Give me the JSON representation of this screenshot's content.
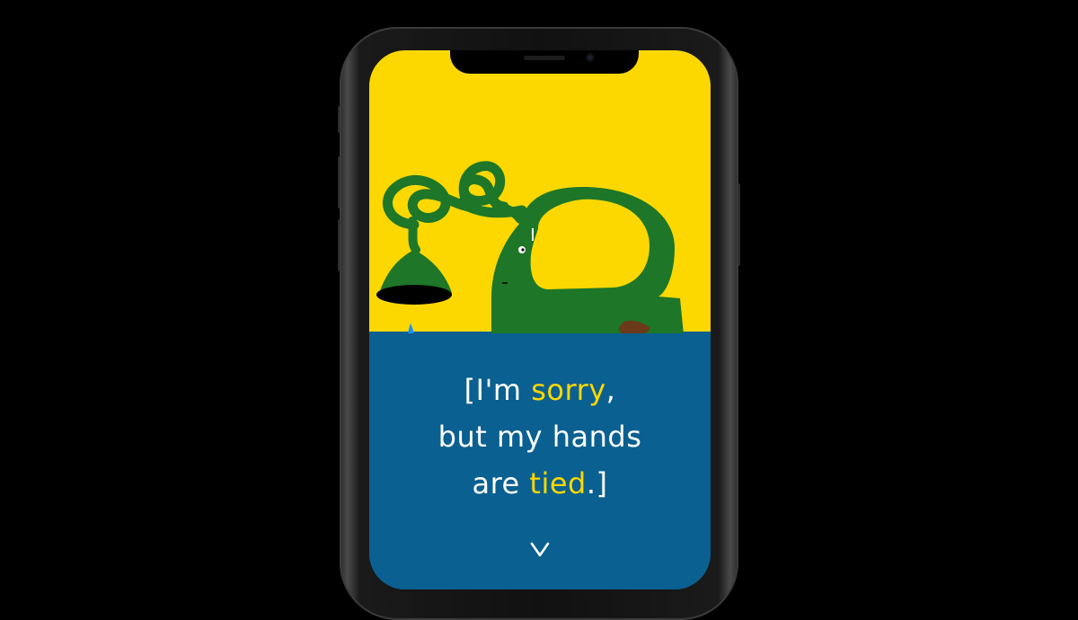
{
  "device": {
    "frame_color": "#111111",
    "screen_top_color": "#fcd800",
    "screen_bottom_color": "#0a6090"
  },
  "illustration": {
    "icon": "tied-faucet-illustration",
    "colors": {
      "body": "#1e7628",
      "drop": "#1e90ff",
      "spout": "#000000",
      "stain": "#6b3a1a"
    }
  },
  "message": {
    "line1_pre": "[I'm ",
    "line1_accent": "sorry",
    "line1_post": ",",
    "line2": "but my hands",
    "line3_pre": "are ",
    "line3_accent": "tied",
    "line3_post": ".]",
    "text_color": "#ffffff",
    "accent_color": "#fcd800"
  },
  "scroll_indicator": {
    "icon": "chevron-down-icon"
  }
}
